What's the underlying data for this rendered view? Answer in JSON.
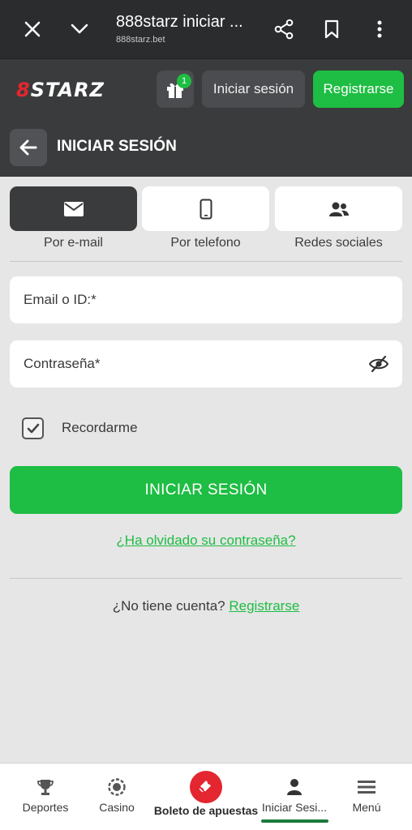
{
  "browser": {
    "title": "888starz iniciar ...",
    "url": "888starz.bet",
    "icons": [
      "close-icon",
      "chevron-down-icon",
      "share-icon",
      "bookmark-icon",
      "more-vert-icon"
    ]
  },
  "header": {
    "logo_prefix": "8",
    "logo_text": "STARZ",
    "gift_badge": "1",
    "login_label": "Iniciar sesión",
    "register_label": "Registrarse"
  },
  "page": {
    "title": "INICIAR SESIÓN"
  },
  "tabs": [
    {
      "label": "Por e-mail",
      "icon": "mail-icon",
      "active": true
    },
    {
      "label": "Por telefono",
      "icon": "phone-icon",
      "active": false
    },
    {
      "label": "Redes sociales",
      "icon": "people-icon",
      "active": false
    }
  ],
  "form": {
    "email_label": "Email o ID:*",
    "password_label": "Contraseña*",
    "remember_label": "Recordarme",
    "remember_checked": true,
    "submit_label": "INICIAR SESIÓN",
    "forgot_label": "¿Ha olvidado su contraseña?",
    "no_account_text": "¿No tiene cuenta?",
    "register_link": "Registrarse"
  },
  "bottom_nav": {
    "items": [
      {
        "label": "Deportes",
        "icon": "trophy-icon"
      },
      {
        "label": "Casino",
        "icon": "chip-icon"
      },
      {
        "label": "Boleto de apuestas",
        "icon": "ticket-icon"
      },
      {
        "label": "Iniciar Sesi...",
        "icon": "user-icon",
        "active": true
      },
      {
        "label": "Menú",
        "icon": "menu-icon"
      }
    ]
  },
  "colors": {
    "accent": "#1ebd43",
    "brand_red": "#e3262f",
    "dark_bg": "#3a3b3d",
    "page_bg": "#e6e6e6"
  }
}
